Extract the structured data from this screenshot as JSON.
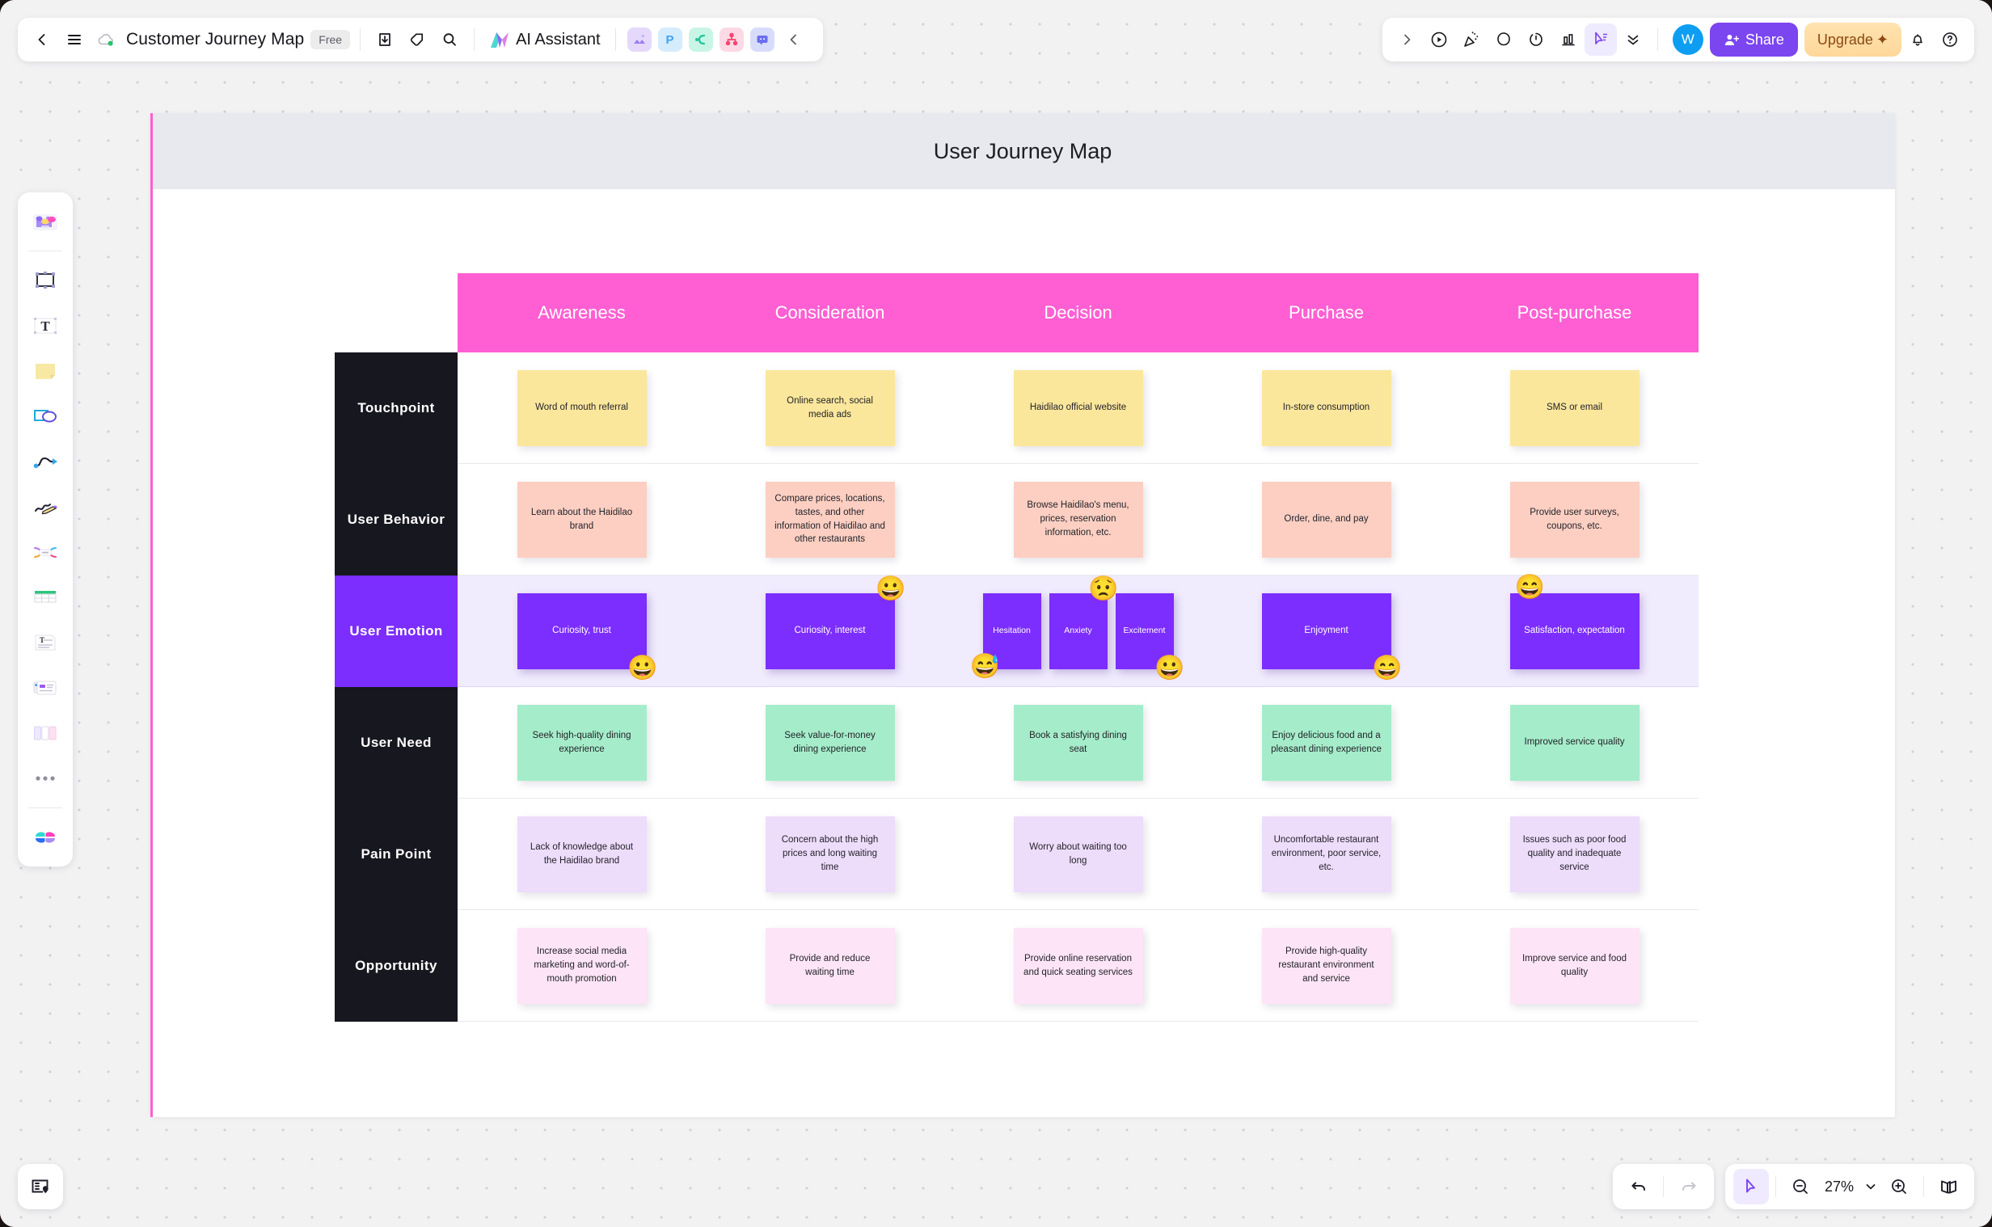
{
  "header": {
    "back_icon": "chevron-left-icon",
    "menu_icon": "hamburger-menu-icon",
    "cloud_icon": "cloud-sync-icon",
    "doc_title": "Customer Journey Map",
    "plan_badge": "Free",
    "export_icon": "download-icon",
    "tag_icon": "tag-icon",
    "search_icon": "search-icon",
    "ai_assistant_label": "AI Assistant",
    "app_icons": [
      {
        "name": "image-generate-icon",
        "glyph": "◢",
        "bg": "#e4d9fb",
        "fg": "#9b7df0"
      },
      {
        "name": "presentation-icon",
        "glyph": "P",
        "bg": "#d5ecfd",
        "fg": "#3fa3f0"
      },
      {
        "name": "mindmap-icon",
        "glyph": "⊂",
        "bg": "#c9f5e6",
        "fg": "#1fc49a"
      },
      {
        "name": "flowchart-icon",
        "glyph": "⑂",
        "bg": "#fcd9e5",
        "fg": "#f7436f"
      },
      {
        "name": "chat-icon",
        "glyph": "▭",
        "bg": "#d8dcfb",
        "fg": "#6a6ef0"
      }
    ],
    "collapse_icon": "chevron-left-icon",
    "right_expand_icon": "chevron-right-icon",
    "present_icon": "present-play-icon",
    "celebrate_icon": "celebrate-icon",
    "comment_icon": "comment-icon",
    "timer_icon": "timer-icon",
    "vote_icon": "vote-chart-icon",
    "cursor_icon": "cursor-select-icon",
    "more_icon": "chevron-double-down-icon",
    "avatar_initial": "W",
    "share_label": "Share",
    "upgrade_label": "Upgrade",
    "upgrade_suffix": "✦",
    "bell_icon": "notification-bell-icon",
    "help_icon": "help-circle-icon"
  },
  "toolrail": {
    "items": [
      {
        "name": "templates-icon",
        "label": "Templates"
      },
      {
        "name": "frame-icon",
        "label": "Frame"
      },
      {
        "name": "text-icon",
        "label": "Text"
      },
      {
        "name": "sticky-note-icon",
        "label": "Sticky Note"
      },
      {
        "name": "shape-icon",
        "label": "Shape"
      },
      {
        "name": "connector-icon",
        "label": "Connector"
      },
      {
        "name": "pen-icon",
        "label": "Pen"
      },
      {
        "name": "mindmap-tool-icon",
        "label": "Mind Map"
      },
      {
        "name": "table-icon",
        "label": "Table"
      },
      {
        "name": "document-icon",
        "label": "Document"
      },
      {
        "name": "card-icon",
        "label": "Card"
      },
      {
        "name": "kanban-icon",
        "label": "Kanban"
      },
      {
        "name": "more-tools-icon",
        "label": "More"
      },
      {
        "name": "color-palette-icon",
        "label": "Colors"
      }
    ]
  },
  "board": {
    "title": "User Journey Map"
  },
  "journey_map": {
    "stages": [
      "Awareness",
      "Consideration",
      "Decision",
      "Purchase",
      "Post-purchase"
    ],
    "rows": [
      {
        "label": "Touchpoint",
        "label_style": "dark",
        "note_color": "yellow",
        "cells": [
          {
            "text": "Word of mouth referral"
          },
          {
            "text": "Online search, social media ads"
          },
          {
            "text": "Haidilao official website"
          },
          {
            "text": "In-store consumption"
          },
          {
            "text": "SMS  or email"
          }
        ]
      },
      {
        "label": "User  Behavior",
        "label_style": "dark",
        "note_color": "peach",
        "cells": [
          {
            "text": "Learn about the Haidilao brand"
          },
          {
            "text": "Compare prices, locations, tastes, and other information of Haidilao and other restaurants"
          },
          {
            "text": "Browse Haidilao's menu, prices, reservation information, etc."
          },
          {
            "text": "Order, dine, and pay"
          },
          {
            "text": "Provide  user surveys, coupons, etc."
          }
        ]
      },
      {
        "label": "User  Emotion",
        "label_style": "purple",
        "note_color": "purple",
        "cells": [
          {
            "text": "Curiosity, trust",
            "emoji": "😀",
            "emoji_pos": "bottom-right"
          },
          {
            "text": "Curiosity, interest",
            "emoji": "😀",
            "emoji_pos": "top-right"
          },
          {
            "multi": [
              {
                "text": "Hesitation",
                "emoji": "😅",
                "emoji_pos": "bottom-left"
              },
              {
                "text": "Anxiety",
                "emoji": "😟",
                "emoji_pos": "top-right"
              },
              {
                "text": "Excitement",
                "emoji": "😀",
                "emoji_pos": "bottom-right"
              }
            ]
          },
          {
            "text": "Enjoyment",
            "emoji": "😄",
            "emoji_pos": "bottom-right"
          },
          {
            "text": "Satisfaction, expectation",
            "emoji": "😄",
            "emoji_pos": "top-left"
          }
        ]
      },
      {
        "label": "User  Need",
        "label_style": "dark",
        "note_color": "mint",
        "cells": [
          {
            "text": "Seek high-quality dining experience"
          },
          {
            "text": "Seek value-for-money dining experience"
          },
          {
            "text": "Book a satisfying dining seat"
          },
          {
            "text": "Enjoy delicious food and a pleasant dining experience"
          },
          {
            "text": "Improved service quality"
          }
        ]
      },
      {
        "label": "Pain  Point",
        "label_style": "dark",
        "note_color": "lilac",
        "cells": [
          {
            "text": "Lack of knowledge about the Haidilao brand"
          },
          {
            "text": "Concern about the high prices and long waiting time"
          },
          {
            "text": "Worry about waiting too long"
          },
          {
            "text": "Uncomfortable restaurant environment, poor service, etc."
          },
          {
            "text": "Issues such as poor food quality and inadequate service"
          }
        ]
      },
      {
        "label": "Opportunity",
        "label_style": "dark",
        "note_color": "pinkpale",
        "cells": [
          {
            "text": "Increase social media marketing and word-of-mouth promotion"
          },
          {
            "text": "Provide and reduce waiting time"
          },
          {
            "text": "Provide online reservation and quick seating services"
          },
          {
            "text": "Provide high-quality restaurant environment and service"
          },
          {
            "text": "Improve service and food quality"
          }
        ]
      }
    ]
  },
  "footer": {
    "minimap_icon": "minimap-location-icon",
    "undo_icon": "undo-icon",
    "redo_icon": "redo-icon",
    "select_icon": "cursor-select-icon",
    "zoom_out_icon": "zoom-out-icon",
    "zoom_level": "27%",
    "zoom_dropdown_icon": "chevron-down-icon",
    "zoom_in_icon": "zoom-in-icon",
    "pages_icon": "pages-book-icon"
  },
  "colors": {
    "accent_purple": "#7c2dff",
    "stage_pink": "#ff5fd2",
    "label_dark": "#17171f",
    "share_purple": "#7b45f0",
    "upgrade_amber": "#ffd79a"
  }
}
